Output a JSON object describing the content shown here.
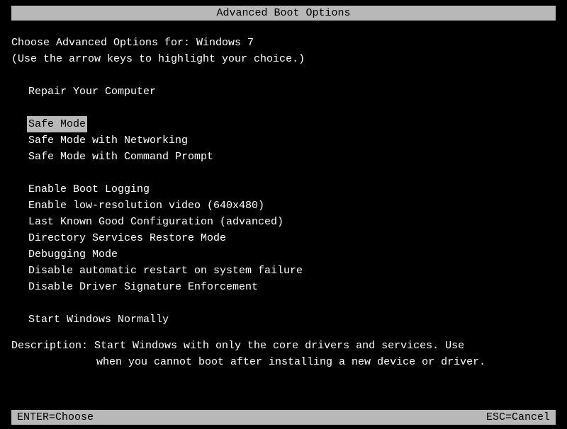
{
  "title": "Advanced Boot Options",
  "header": {
    "choose_line": "Choose Advanced Options for: Windows 7",
    "hint_line": "(Use the arrow keys to highlight your choice.)"
  },
  "menu": {
    "items": [
      {
        "label": "Repair Your Computer",
        "selected": false
      },
      {
        "label": "Safe Mode",
        "selected": true
      },
      {
        "label": "Safe Mode with Networking",
        "selected": false
      },
      {
        "label": "Safe Mode with Command Prompt",
        "selected": false
      },
      {
        "label": "Enable Boot Logging",
        "selected": false
      },
      {
        "label": "Enable low-resolution video (640x480)",
        "selected": false
      },
      {
        "label": "Last Known Good Configuration (advanced)",
        "selected": false
      },
      {
        "label": "Directory Services Restore Mode",
        "selected": false
      },
      {
        "label": "Debugging Mode",
        "selected": false
      },
      {
        "label": "Disable automatic restart on system failure",
        "selected": false
      },
      {
        "label": "Disable Driver Signature Enforcement",
        "selected": false
      },
      {
        "label": "Start Windows Normally",
        "selected": false
      }
    ]
  },
  "description": {
    "label": "Description:",
    "line1": "Description: Start Windows with only the core drivers and services. Use",
    "line2": "when you cannot boot after installing a new device or driver."
  },
  "footer": {
    "enter": "ENTER=Choose",
    "esc": "ESC=Cancel"
  }
}
